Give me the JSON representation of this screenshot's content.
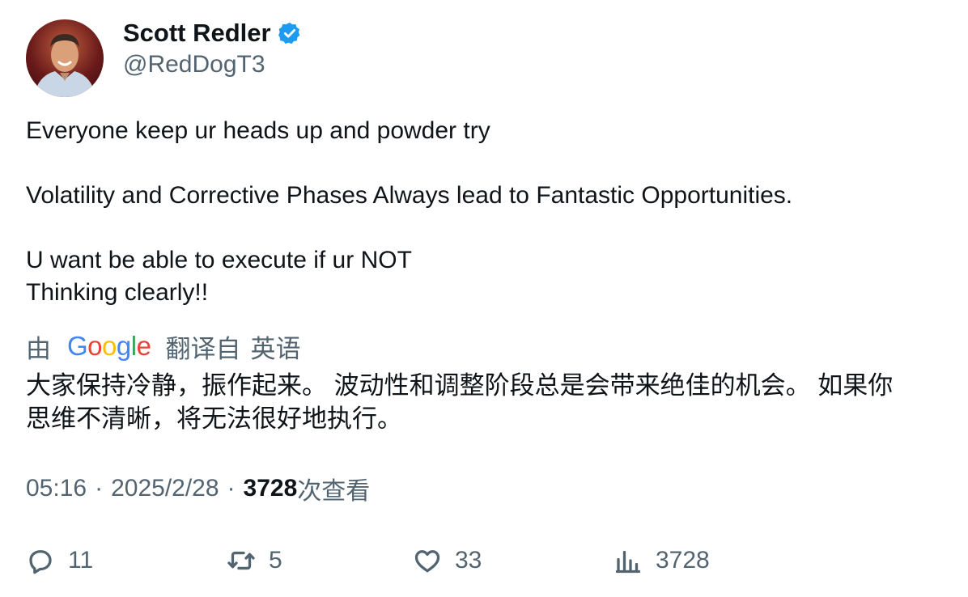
{
  "author": {
    "name": "Scott Redler",
    "handle": "@RedDogT3",
    "verified_color": "#1d9bf0"
  },
  "tweet": {
    "lines": [
      "Everyone keep ur heads up and powder try",
      "",
      "Volatility and Corrective Phases Always lead to Fantastic Opportunities.",
      "",
      "U want be able to execute if ur NOT",
      "Thinking clearly!!"
    ]
  },
  "translation": {
    "prefix": "由",
    "provider": "Google",
    "from_label": "翻译自",
    "language": "英语",
    "text_line1": "大家保持冷静，振作起来。 波动性和调整阶段总是会带来绝佳的机会。 如果你",
    "text_line2": "思维不清晰，将无法很好地执行。"
  },
  "meta": {
    "time": "05:16",
    "separator": "·",
    "date": "2025/2/28",
    "views_count": "3728",
    "views_label": "次查看"
  },
  "actions": {
    "reply_count": "11",
    "retweet_count": "5",
    "like_count": "33",
    "views_count": "3728"
  }
}
